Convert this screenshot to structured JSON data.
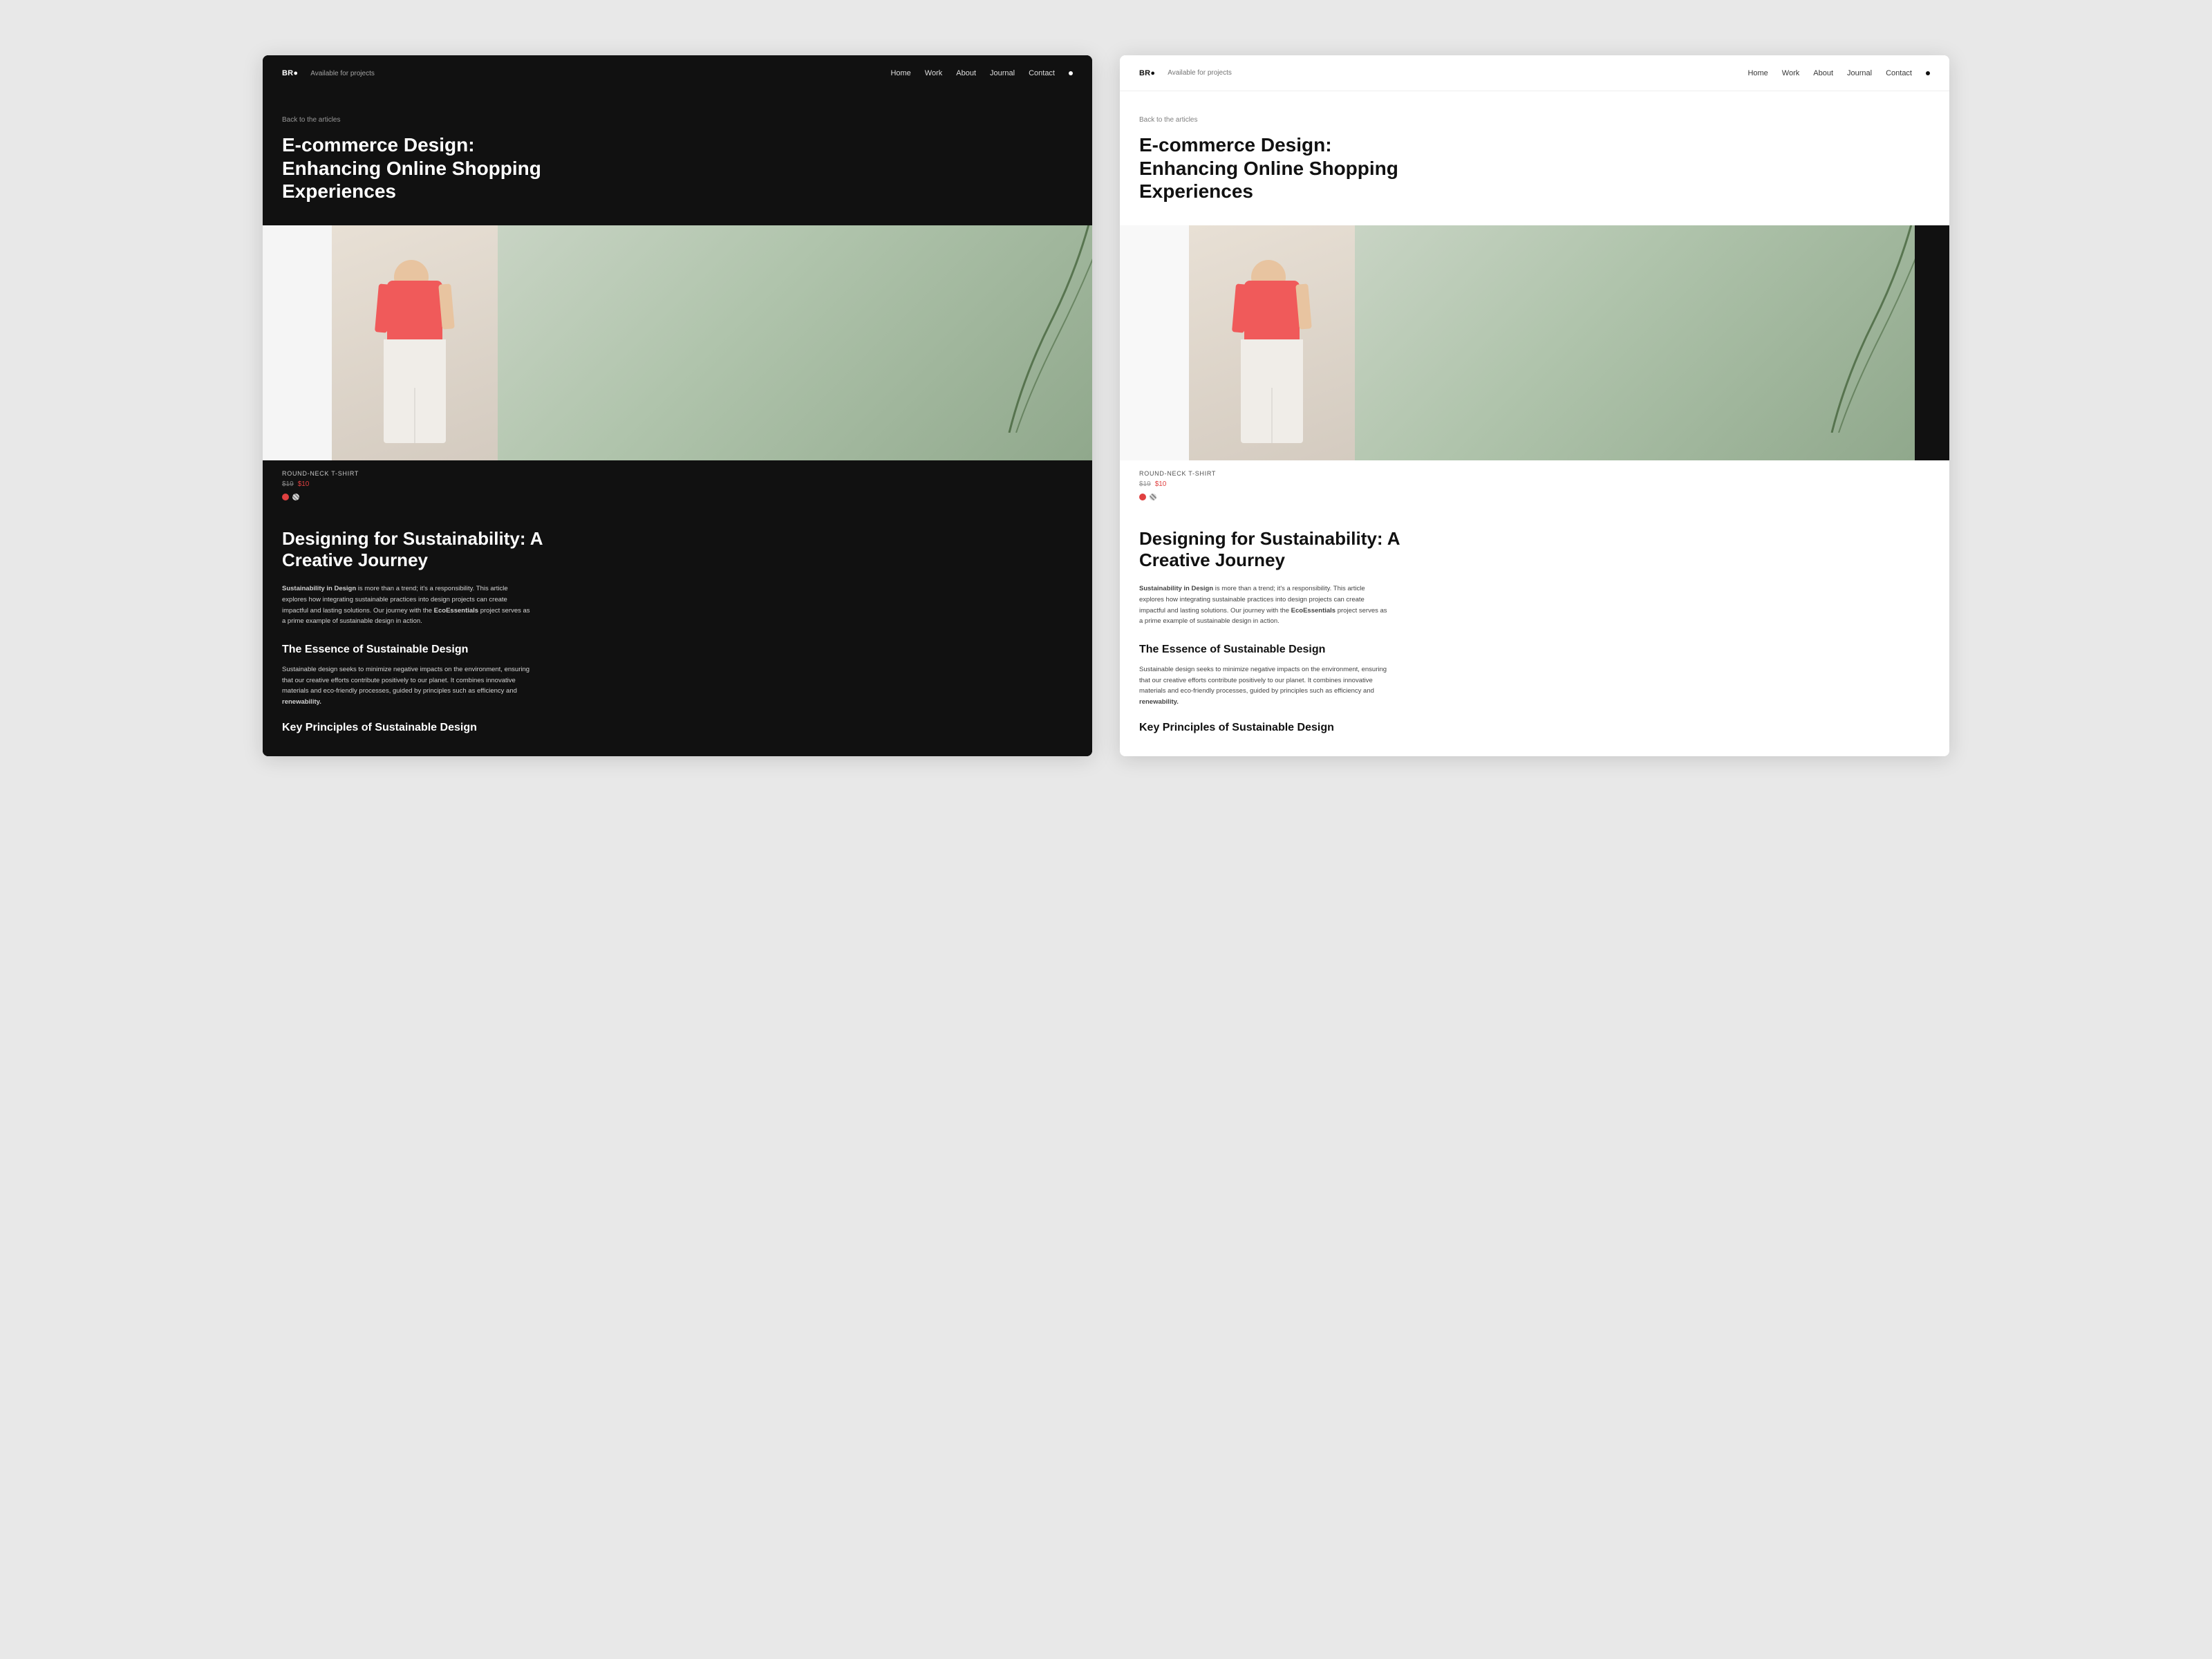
{
  "windows": [
    {
      "id": "dark-window",
      "theme": "dark",
      "nav": {
        "logo": "BR●",
        "available": "Available for projects",
        "links": [
          "Home",
          "Work",
          "About",
          "Journal",
          "Contact"
        ],
        "dot": "●"
      },
      "hero": {
        "back_link": "Back to the articles",
        "title": "E-commerce Design: Enhancing Online Shopping Experiences"
      },
      "product": {
        "name": "ROUND-NECK T-SHIRT",
        "price_old": "$19",
        "price_new": "$10"
      },
      "article": {
        "main_title": "Designing for Sustainability: A Creative Journey",
        "body_bold": "Sustainability in Design",
        "body_text": " is more than a trend; it's a responsibility. This article explores how integrating sustainable practices into design projects can create impactful and lasting solutions. Our journey with the ",
        "eco_bold": "EcoEssentials",
        "body_end": " project serves as a prime example of sustainable design in action.",
        "essence_title": "The Essence of Sustainable Design",
        "essence_body": "Sustainable design seeks to minimize negative impacts on the environment, ensuring that our creative efforts contribute positively to our planet. It combines innovative materials and eco-friendly processes, guided by principles such as efficiency and ",
        "essence_bold": "renewability.",
        "key_title": "Key Principles of Sustainable Design"
      }
    },
    {
      "id": "light-window",
      "theme": "light",
      "nav": {
        "logo": "BR●",
        "available": "Available for projects",
        "links": [
          "Home",
          "Work",
          "About",
          "Journal",
          "Contact"
        ],
        "dot": "●"
      },
      "hero": {
        "back_link": "Back to the articles",
        "title": "E-commerce Design: Enhancing Online Shopping Experiences"
      },
      "product": {
        "name": "ROUND-NECK T-SHIRT",
        "price_old": "$19",
        "price_new": "$10"
      },
      "article": {
        "main_title": "Designing for Sustainability: A Creative Journey",
        "body_bold": "Sustainability in Design",
        "body_text": " is more than a trend; it's a responsibility. This article explores how integrating sustainable practices into design projects can create impactful and lasting solutions. Our journey with the ",
        "eco_bold": "EcoEssentials",
        "body_end": " project serves as a prime example of sustainable design in action.",
        "essence_title": "The Essence of Sustainable Design",
        "essence_body": "Sustainable design seeks to minimize negative impacts on the environment, ensuring that our creative efforts contribute positively to our planet. It combines innovative materials and eco-friendly processes, guided by principles such as efficiency and ",
        "essence_bold": "renewability.",
        "key_title": "Key Principles of Sustainable Design"
      }
    }
  ]
}
